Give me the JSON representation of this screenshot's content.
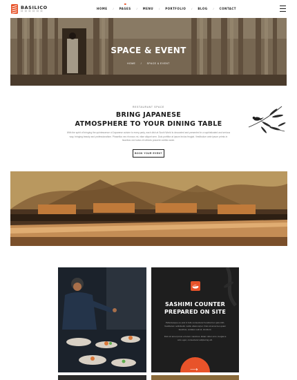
{
  "brand": {
    "name": "BASILICO",
    "tagline": "ロ ロ ロ ロ ロ ロ",
    "accent": "#e8532a"
  },
  "nav": {
    "items": [
      "HOME",
      "PAGES",
      "MENU",
      "PORTFOLIO",
      "BLOG",
      "CONTACT"
    ],
    "separator": "/",
    "active": "PAGES"
  },
  "hero": {
    "title": "SPACE & EVENT",
    "breadcrumb": {
      "home": "HOME",
      "separator": "/",
      "current": "SPACE & EVENT"
    }
  },
  "intro": {
    "eyebrow": "RESTAURANT SPACE",
    "title_line1": "BRING JAPANESE",
    "title_line2": "ATMOSPHERE TO YOUR DINING TABLE",
    "paragraph": "With the spirit of bringing the quintessence of Japanese cuisine to every party, each dish at Sushi World is decorated and presented in a sophisticated and serious way, bringing beauty and professionalism. Phasellus nec rhoncus mi, vitae aliquet sem. Duis porttitor at ipsum lectus feugiat. Vestibulum ante ipsum primis in faucibus orci luctus et ultrices posuere cubilia curae.",
    "button": "BOOK YOUR EVENT"
  },
  "card": {
    "title_line1": "SASHIMI COUNTER",
    "title_line2": "PREPARED ON SITE",
    "text1": "Pellentesque eu erat in felis consectetur hendrerit ut quis nibh. Vestibulum sollicitudin mollis ullamcorper. Duis sit amet leo quam faucibus, sodales velit id, tincidunt.",
    "text2": "Duis sit amet purus et lorem maximus. Etiam dolor eros, feugiat a arcu eget, consectetur adipiscing elit.",
    "arrow": "⟶"
  }
}
